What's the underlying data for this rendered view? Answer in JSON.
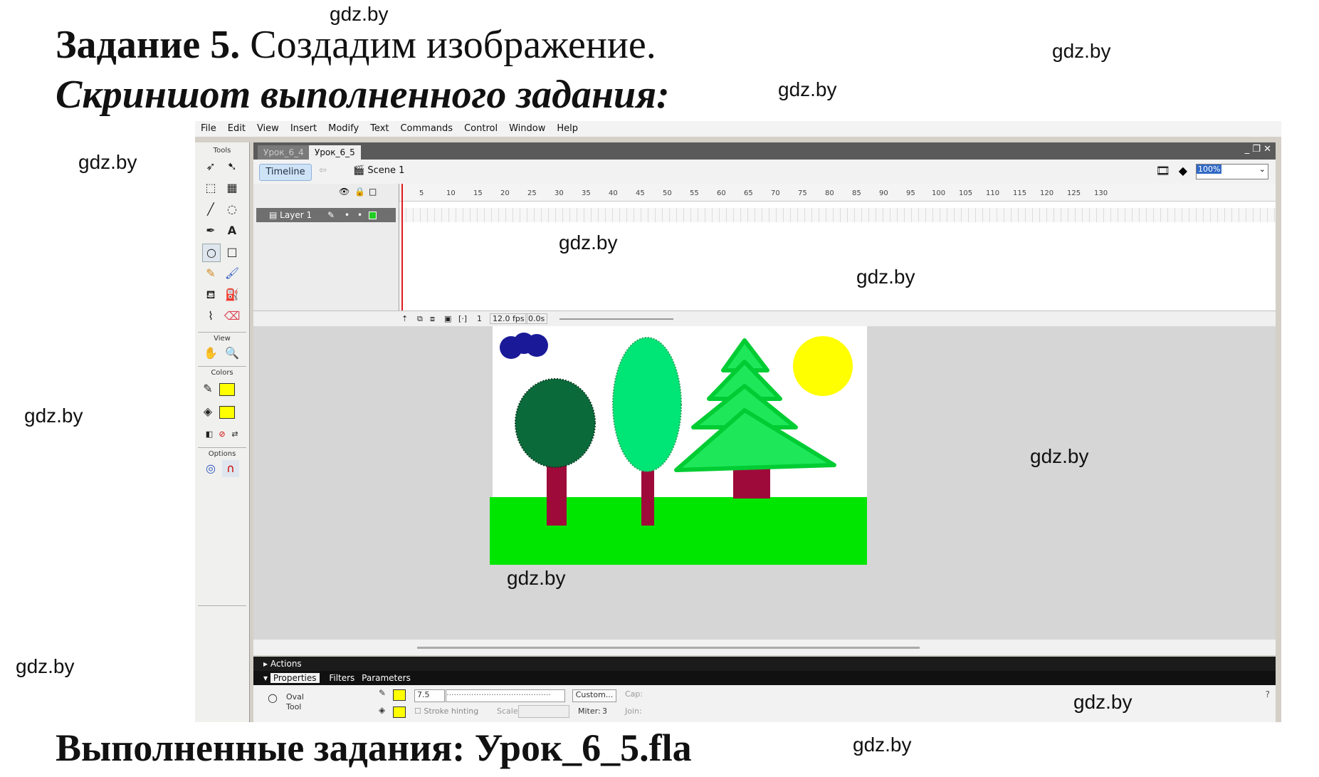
{
  "headings": {
    "task_bold": "Задание 5.",
    "task_rest": " Создадим изображение.",
    "screenshot_caption": "Скриншот выполненного задания:",
    "done_caption": "Выполненные задания: Урок_6_5.fla"
  },
  "watermark": "gdz.by",
  "menu": [
    "File",
    "Edit",
    "View",
    "Insert",
    "Modify",
    "Text",
    "Commands",
    "Control",
    "Window",
    "Help"
  ],
  "tools": {
    "header": "Tools",
    "view_header": "View",
    "colors_header": "Colors",
    "options_header": "Options",
    "stroke_color": "#ffff00",
    "fill_color": "#ffff00"
  },
  "document": {
    "tabs": [
      "Урок_6_4",
      "Урок_6_5"
    ],
    "active_tab": "Урок_6_5",
    "timeline_button": "Timeline",
    "scene": "Scene 1",
    "zoom": "100%"
  },
  "timeline": {
    "layer_name": "Layer 1",
    "ruler_ticks": [
      "5",
      "10",
      "15",
      "20",
      "25",
      "30",
      "35",
      "40",
      "45",
      "50",
      "55",
      "60",
      "65",
      "70",
      "75",
      "80",
      "85",
      "90",
      "95",
      "100",
      "105",
      "110",
      "115",
      "120",
      "125",
      "130"
    ],
    "current_frame": "1",
    "fps": "12.0 fps",
    "time": "0.0s"
  },
  "panels": {
    "actions": "Actions",
    "properties": "Properties",
    "filters": "Filters",
    "parameters": "Parameters"
  },
  "properties": {
    "tool_name": "Oval",
    "tool_sub": "Tool",
    "stroke_height": "7.5",
    "custom_button": "Custom...",
    "cap_label": "Cap:",
    "stroke_hinting": "Stroke hinting",
    "scale_label": "Scale:",
    "miter_label": "Miter:",
    "miter_value": "3",
    "join_label": "Join:"
  },
  "colors": {
    "grass": "#00e600",
    "dark_tree": "#0b6a3a",
    "light_tree": "#00e676",
    "trunk": "#9e0b3a",
    "fir": "#1ee85a",
    "sun": "#ffff00",
    "cloud": "#1a1a99"
  }
}
